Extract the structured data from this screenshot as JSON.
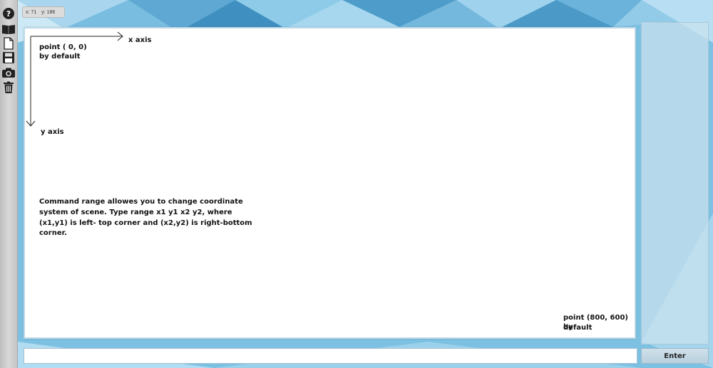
{
  "toolbar": {
    "icons": [
      "help-icon",
      "book-icon",
      "new-file-icon",
      "save-icon",
      "camera-icon",
      "trash-icon"
    ]
  },
  "coordinates": {
    "x_text": "x: 71",
    "y_text": "y: 186"
  },
  "canvas": {
    "x_axis_label": "x axis",
    "y_axis_label": "y axis",
    "origin_label_line1": "point ( 0, 0)",
    "origin_label_line2": "by default",
    "help_line1": "Command range allowes you to change coordinate",
    "help_line2": "system of scene. Type range x1 y1 x2 y2, where",
    "help_line3": "(x1,y1) is left- top corner and (x2,y2) is right-bottom",
    "help_line4": "corner.",
    "end_label_line1": "point (800, 600) by",
    "end_label_line2": "default"
  },
  "command": {
    "input_value": "",
    "enter_label": "Enter"
  },
  "colors": {
    "background": "#6fb6dc",
    "panel": "#c8e1ee"
  }
}
